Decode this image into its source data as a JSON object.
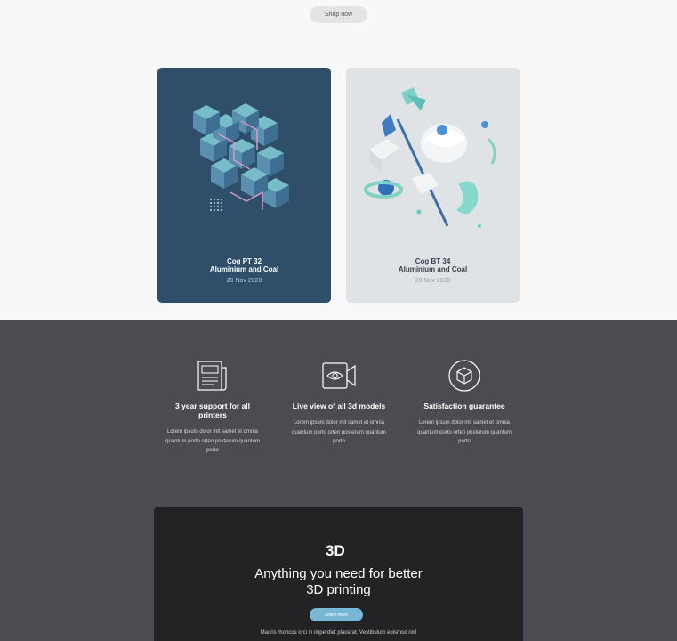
{
  "top": {
    "shop_label": "Shop now"
  },
  "cards": [
    {
      "title_line1": "Cog PT 32",
      "title_line2": "Aluminium and Coal",
      "date": "28 Nov 2020"
    },
    {
      "title_line1": "Cog BT 34",
      "title_line2": "Aluminium and Coal",
      "date": "28 Nov 2020"
    }
  ],
  "features": [
    {
      "icon": "newspaper-icon",
      "title": "3 year support for all printers",
      "body": "Lorem ipsum dolor mit samet et omnia quantum porto orten posterum quantum porto"
    },
    {
      "icon": "video-eye-icon",
      "title": "Live view of all 3d models",
      "body": "Lorem ipsum dolor mit samet et omnia quantum porto orten posterum quantum porto"
    },
    {
      "icon": "cube-icon",
      "title": "Satisfaction guarantee",
      "body": "Lorem ipsum dolor mit samet et omnia quantum porto orten posterum quantum porto"
    }
  ],
  "promo": {
    "logo_text": "3D",
    "heading_line1": "Anything you need for better",
    "heading_line2": "3D printing",
    "button_label": "Learn more",
    "body": "Mauris rhoncus orci in imperdiet placerat. Vestibulum euismod nisl"
  },
  "colors": {
    "card_left": "#2e4e6a",
    "card_right": "#dfe3e6",
    "mid_bg": "#4b4b51",
    "dark_bg": "#232325",
    "accent": "#78b8d6"
  }
}
